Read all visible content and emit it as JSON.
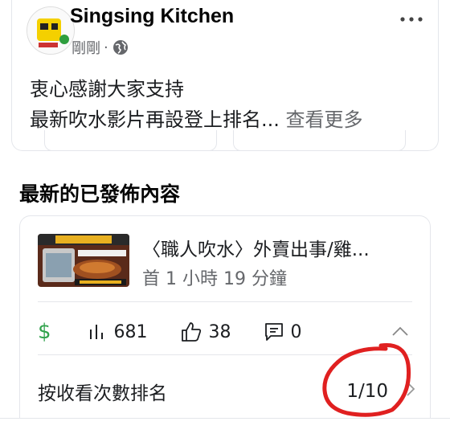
{
  "post": {
    "page_name": "Singsing Kitchen",
    "time": "剛剛",
    "separator": "·",
    "text_line1": "衷心感謝大家支持",
    "text_line2": "最新吹水影片再設登上排名...",
    "see_more": "查看更多"
  },
  "section": {
    "title": "最新的已發佈內容"
  },
  "content": {
    "video_title": "〈職人吹水〉外賣出事/雞...",
    "published": "首 1 小時 19 分鐘",
    "stats": {
      "views": "681",
      "likes": "38",
      "comments": "0"
    },
    "rank_label": "按收看次數排名",
    "rank_value": "1/10"
  },
  "colors": {
    "money_green": "#31a24c",
    "annotation_red": "#e02020",
    "muted_text": "#65676b"
  },
  "icons": [
    "globe-icon",
    "more-dots-icon",
    "dollar-icon",
    "bar-chart-icon",
    "thumbs-up-icon",
    "comment-icon",
    "chevron-up-icon",
    "chevron-right-icon"
  ]
}
